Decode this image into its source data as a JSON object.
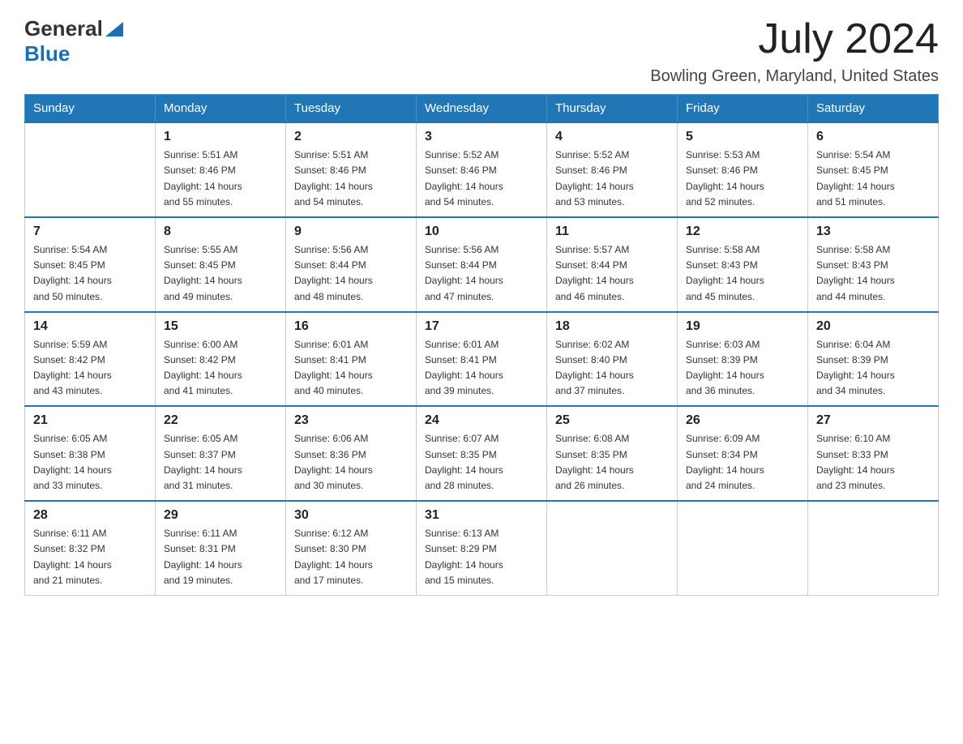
{
  "header": {
    "logo": {
      "general": "General",
      "triangle": "▶",
      "blue": "Blue"
    },
    "title": "July 2024",
    "location": "Bowling Green, Maryland, United States"
  },
  "days_of_week": [
    "Sunday",
    "Monday",
    "Tuesday",
    "Wednesday",
    "Thursday",
    "Friday",
    "Saturday"
  ],
  "weeks": [
    [
      {
        "day": "",
        "info": ""
      },
      {
        "day": "1",
        "info": "Sunrise: 5:51 AM\nSunset: 8:46 PM\nDaylight: 14 hours\nand 55 minutes."
      },
      {
        "day": "2",
        "info": "Sunrise: 5:51 AM\nSunset: 8:46 PM\nDaylight: 14 hours\nand 54 minutes."
      },
      {
        "day": "3",
        "info": "Sunrise: 5:52 AM\nSunset: 8:46 PM\nDaylight: 14 hours\nand 54 minutes."
      },
      {
        "day": "4",
        "info": "Sunrise: 5:52 AM\nSunset: 8:46 PM\nDaylight: 14 hours\nand 53 minutes."
      },
      {
        "day": "5",
        "info": "Sunrise: 5:53 AM\nSunset: 8:46 PM\nDaylight: 14 hours\nand 52 minutes."
      },
      {
        "day": "6",
        "info": "Sunrise: 5:54 AM\nSunset: 8:45 PM\nDaylight: 14 hours\nand 51 minutes."
      }
    ],
    [
      {
        "day": "7",
        "info": "Sunrise: 5:54 AM\nSunset: 8:45 PM\nDaylight: 14 hours\nand 50 minutes."
      },
      {
        "day": "8",
        "info": "Sunrise: 5:55 AM\nSunset: 8:45 PM\nDaylight: 14 hours\nand 49 minutes."
      },
      {
        "day": "9",
        "info": "Sunrise: 5:56 AM\nSunset: 8:44 PM\nDaylight: 14 hours\nand 48 minutes."
      },
      {
        "day": "10",
        "info": "Sunrise: 5:56 AM\nSunset: 8:44 PM\nDaylight: 14 hours\nand 47 minutes."
      },
      {
        "day": "11",
        "info": "Sunrise: 5:57 AM\nSunset: 8:44 PM\nDaylight: 14 hours\nand 46 minutes."
      },
      {
        "day": "12",
        "info": "Sunrise: 5:58 AM\nSunset: 8:43 PM\nDaylight: 14 hours\nand 45 minutes."
      },
      {
        "day": "13",
        "info": "Sunrise: 5:58 AM\nSunset: 8:43 PM\nDaylight: 14 hours\nand 44 minutes."
      }
    ],
    [
      {
        "day": "14",
        "info": "Sunrise: 5:59 AM\nSunset: 8:42 PM\nDaylight: 14 hours\nand 43 minutes."
      },
      {
        "day": "15",
        "info": "Sunrise: 6:00 AM\nSunset: 8:42 PM\nDaylight: 14 hours\nand 41 minutes."
      },
      {
        "day": "16",
        "info": "Sunrise: 6:01 AM\nSunset: 8:41 PM\nDaylight: 14 hours\nand 40 minutes."
      },
      {
        "day": "17",
        "info": "Sunrise: 6:01 AM\nSunset: 8:41 PM\nDaylight: 14 hours\nand 39 minutes."
      },
      {
        "day": "18",
        "info": "Sunrise: 6:02 AM\nSunset: 8:40 PM\nDaylight: 14 hours\nand 37 minutes."
      },
      {
        "day": "19",
        "info": "Sunrise: 6:03 AM\nSunset: 8:39 PM\nDaylight: 14 hours\nand 36 minutes."
      },
      {
        "day": "20",
        "info": "Sunrise: 6:04 AM\nSunset: 8:39 PM\nDaylight: 14 hours\nand 34 minutes."
      }
    ],
    [
      {
        "day": "21",
        "info": "Sunrise: 6:05 AM\nSunset: 8:38 PM\nDaylight: 14 hours\nand 33 minutes."
      },
      {
        "day": "22",
        "info": "Sunrise: 6:05 AM\nSunset: 8:37 PM\nDaylight: 14 hours\nand 31 minutes."
      },
      {
        "day": "23",
        "info": "Sunrise: 6:06 AM\nSunset: 8:36 PM\nDaylight: 14 hours\nand 30 minutes."
      },
      {
        "day": "24",
        "info": "Sunrise: 6:07 AM\nSunset: 8:35 PM\nDaylight: 14 hours\nand 28 minutes."
      },
      {
        "day": "25",
        "info": "Sunrise: 6:08 AM\nSunset: 8:35 PM\nDaylight: 14 hours\nand 26 minutes."
      },
      {
        "day": "26",
        "info": "Sunrise: 6:09 AM\nSunset: 8:34 PM\nDaylight: 14 hours\nand 24 minutes."
      },
      {
        "day": "27",
        "info": "Sunrise: 6:10 AM\nSunset: 8:33 PM\nDaylight: 14 hours\nand 23 minutes."
      }
    ],
    [
      {
        "day": "28",
        "info": "Sunrise: 6:11 AM\nSunset: 8:32 PM\nDaylight: 14 hours\nand 21 minutes."
      },
      {
        "day": "29",
        "info": "Sunrise: 6:11 AM\nSunset: 8:31 PM\nDaylight: 14 hours\nand 19 minutes."
      },
      {
        "day": "30",
        "info": "Sunrise: 6:12 AM\nSunset: 8:30 PM\nDaylight: 14 hours\nand 17 minutes."
      },
      {
        "day": "31",
        "info": "Sunrise: 6:13 AM\nSunset: 8:29 PM\nDaylight: 14 hours\nand 15 minutes."
      },
      {
        "day": "",
        "info": ""
      },
      {
        "day": "",
        "info": ""
      },
      {
        "day": "",
        "info": ""
      }
    ]
  ]
}
